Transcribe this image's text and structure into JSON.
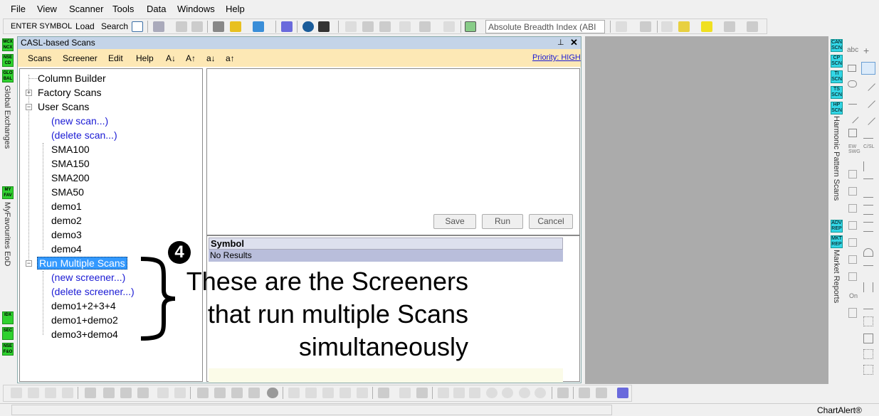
{
  "menu": {
    "file": "File",
    "view": "View",
    "scanner": "Scanner",
    "tools": "Tools",
    "data": "Data",
    "windows": "Windows",
    "help": "Help"
  },
  "toolbar": {
    "enter_symbol": "ENTER SYMBOL",
    "load": "Load",
    "search": "Search",
    "indicator_select": "Absolute Breadth Index (ABI"
  },
  "left_tabs": {
    "mcx": "MCX NCX",
    "nse_cd": "NSE CD",
    "global": "GLO BAL",
    "global_exchanges": "Global Exchanges",
    "my_fav": "MY FAV",
    "my_favourites": "MyFavourites EoD",
    "idx": "IDX",
    "sec": "SEC",
    "nse_fo": "NSE F&O"
  },
  "panel": {
    "title": "CASL-based Scans",
    "menu": {
      "scans": "Scans",
      "screener": "Screener",
      "edit": "Edit",
      "help": "Help",
      "priority": "Priority: HIGH"
    },
    "tree": {
      "column_builder": "Column Builder",
      "factory_scans": "Factory Scans",
      "user_scans": "User Scans",
      "new_scan": "(new scan...)",
      "delete_scan": "(delete scan...)",
      "scans": [
        "SMA100",
        "SMA150",
        "SMA200",
        "SMA50",
        "demo1",
        "demo2",
        "demo3",
        "demo4"
      ],
      "run_multiple": "Run Multiple Scans",
      "new_screener": "(new screener...)",
      "delete_screener": "(delete screener...)",
      "screeners": [
        "demo1+2+3+4",
        "demo1+demo2",
        "demo3+demo4"
      ]
    },
    "buttons": {
      "save": "Save",
      "run": "Run",
      "cancel": "Cancel"
    },
    "results": {
      "header": "Symbol",
      "empty": "No Results"
    }
  },
  "annotation": {
    "number": "4",
    "line1": "These are the Screeners",
    "line2": "that run multiple Scans",
    "line3": "simultaneously"
  },
  "right_tabs": {
    "can_scn": "CAN SCN",
    "cp_scn": "CP SCN",
    "ti_scn": "TI SCN",
    "ts_scn": "TS SCN",
    "hp_scn": "HP SCN",
    "harmonic": "Harmonic Pattern Scans",
    "adv_rep": "ADV REP",
    "mkt_rep": "MKT REP",
    "market_reports": "Market Reports"
  },
  "status": {
    "brand": "ChartAlert®"
  }
}
